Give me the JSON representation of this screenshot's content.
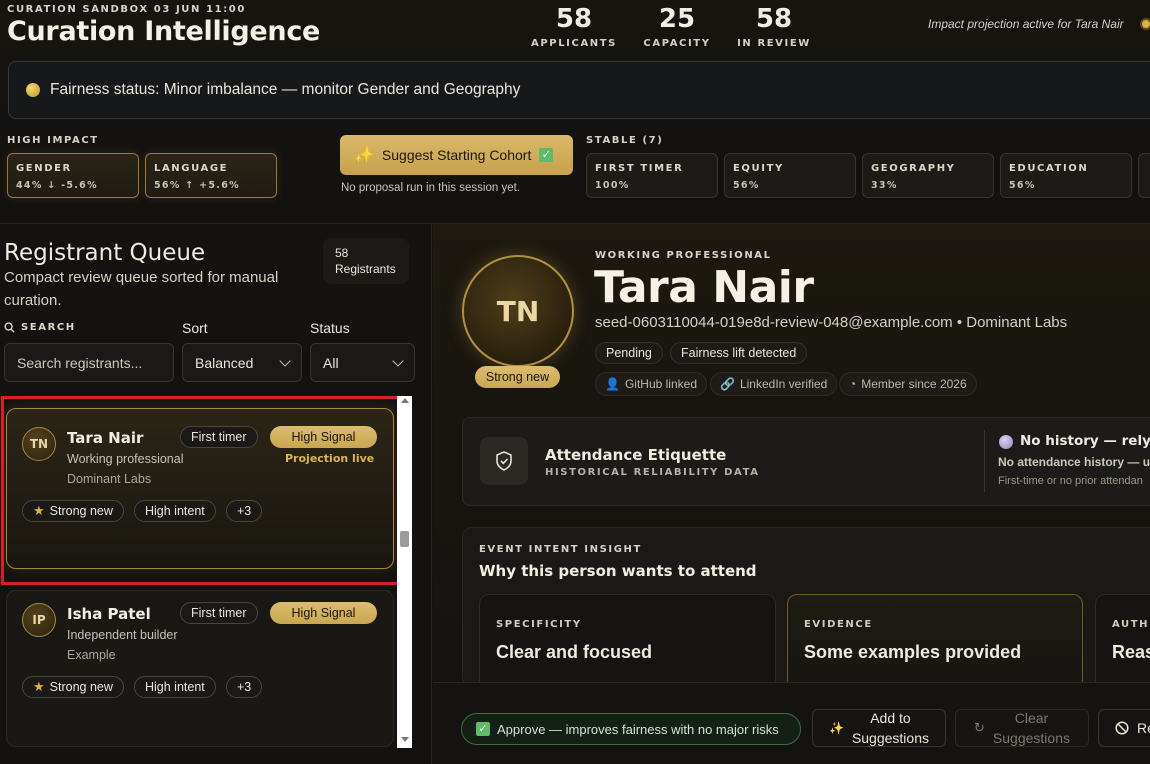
{
  "header": {
    "sandbox_label": "CURATION SANDBOX 03 JUN 11:00",
    "app_title": "Curation Intelligence",
    "stats": [
      {
        "value": "58",
        "label": "APPLICANTS"
      },
      {
        "value": "25",
        "label": "CAPACITY"
      },
      {
        "value": "58",
        "label": "IN REVIEW"
      }
    ],
    "impact_text": "Impact projection active for Tara Nair"
  },
  "fairness": {
    "text": "Fairness status: Minor imbalance — monitor Gender and Geography",
    "dot_color": "#d4b050"
  },
  "high_impact": {
    "label": "HIGH IMPACT",
    "items": [
      {
        "name": "GENDER",
        "value": "44% ↓ -5.6%"
      },
      {
        "name": "LANGUAGE",
        "value": "56% ↑ +5.6%"
      }
    ]
  },
  "suggest": {
    "button_label": "Suggest Starting Cohort",
    "status": "No proposal run in this session yet."
  },
  "stable": {
    "label": "STABLE (7)",
    "items": [
      {
        "name": "FIRST TIMER",
        "value": "100%"
      },
      {
        "name": "EQUITY",
        "value": "56%"
      },
      {
        "name": "GEOGRAPHY",
        "value": "33%"
      },
      {
        "name": "EDUCATION",
        "value": "56%"
      }
    ]
  },
  "queue": {
    "title": "Registrant Queue",
    "description": "Compact review queue sorted for manual curation.",
    "count_line1": "58",
    "count_line2": "Registrants",
    "search_label": "SEARCH",
    "search_placeholder": "Search registrants...",
    "sort_label": "Sort",
    "sort_value": "Balanced",
    "status_label": "Status",
    "status_value": "All"
  },
  "cards": [
    {
      "initials": "TN",
      "name": "Tara Nair",
      "role": "Working professional",
      "org": "Dominant Labs",
      "tag": "First timer",
      "signal": "High Signal",
      "projection": "Projection live",
      "chips": [
        "Strong new",
        "High intent",
        "+3"
      ]
    },
    {
      "initials": "IP",
      "name": "Isha Patel",
      "role": "Independent builder",
      "org": "Example",
      "tag": "First timer",
      "signal": "High Signal",
      "chips": [
        "Strong new",
        "High intent",
        "+3"
      ]
    }
  ],
  "profile": {
    "initials": "TN",
    "badge": "Strong new",
    "category": "WORKING PROFESSIONAL",
    "name": "Tara Nair",
    "email_line": "seed-0603110044-019e8d-review-048@example.com • Dominant Labs",
    "tags": [
      "Pending",
      "Fairness lift detected"
    ],
    "social": [
      "GitHub linked",
      "LinkedIn verified",
      "Member since 2026"
    ]
  },
  "attendance": {
    "title": "Attendance Etiquette",
    "subtitle": "HISTORICAL RELIABILITY DATA",
    "history_title": "No history — rely o",
    "history_sub": "No attendance history — u",
    "history_note": "First-time or no prior attendan"
  },
  "intent": {
    "label": "EVENT INTENT INSIGHT",
    "title": "Why this person wants to attend",
    "insights": [
      {
        "key": "SPECIFICITY",
        "value": "Clear and focused"
      },
      {
        "key": "EVIDENCE",
        "value": "Some examples provided"
      },
      {
        "key": "AUTHE",
        "value": "Reas"
      }
    ]
  },
  "actions": {
    "approve_text": "Approve — improves fairness with no major risks",
    "add_line1": "Add to",
    "add_line2": "Suggestions",
    "clear_line1": "Clear",
    "clear_line2": "Suggestions",
    "reject_text": "Re"
  }
}
